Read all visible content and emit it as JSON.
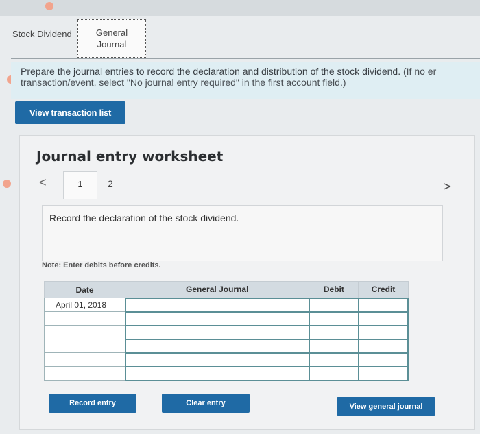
{
  "tabs": {
    "stock_dividend": "Stock Dividend",
    "general_journal_line1": "General",
    "general_journal_line2": "Journal"
  },
  "instructions": {
    "line1_main": "Prepare the journal entries to record the declaration and distribution of the stock dividend.",
    "line1_hint": "(If no er",
    "line2_hint": "transaction/event, select \"No journal entry required\" in the first account field.)"
  },
  "buttons": {
    "view_transaction_list": "View transaction list",
    "record_entry": "Record entry",
    "clear_entry": "Clear entry",
    "view_general_journal": "View general journal"
  },
  "worksheet": {
    "title": "Journal entry worksheet",
    "prev": "<",
    "next": ">",
    "steps": [
      "1",
      "2"
    ],
    "description": "Record the declaration of the stock dividend.",
    "note": "Note: Enter debits before credits."
  },
  "table": {
    "headers": {
      "date": "Date",
      "general_journal": "General Journal",
      "debit": "Debit",
      "credit": "Credit"
    },
    "rows": [
      {
        "date": "April 01, 2018",
        "account": "",
        "debit": "",
        "credit": ""
      },
      {
        "date": "",
        "account": "",
        "debit": "",
        "credit": ""
      },
      {
        "date": "",
        "account": "",
        "debit": "",
        "credit": ""
      },
      {
        "date": "",
        "account": "",
        "debit": "",
        "credit": ""
      },
      {
        "date": "",
        "account": "",
        "debit": "",
        "credit": ""
      },
      {
        "date": "",
        "account": "",
        "debit": "",
        "credit": ""
      }
    ]
  },
  "colors": {
    "primary_button": "#1f6aa5",
    "instruction_bg": "#dfeef3",
    "table_header_bg": "#d3dbe1"
  }
}
